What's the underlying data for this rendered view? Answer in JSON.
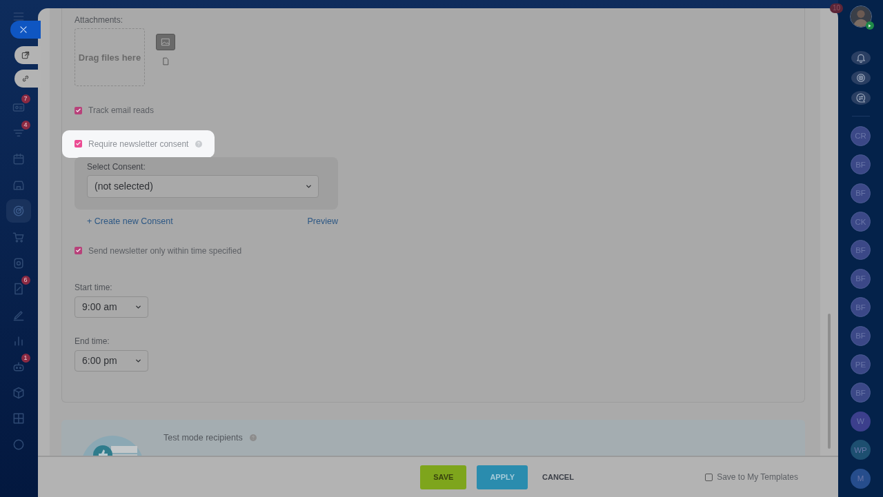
{
  "left_nav": {
    "items": [
      {
        "selected": false,
        "badge": "7"
      },
      {
        "selected": false,
        "badge": "4"
      },
      {
        "selected": false
      },
      {
        "selected": false
      },
      {
        "selected": true
      },
      {
        "selected": false
      },
      {
        "selected": false
      },
      {
        "selected": false,
        "badge": "6"
      },
      {
        "selected": false
      },
      {
        "selected": false
      },
      {
        "selected": false,
        "badge": "1"
      },
      {
        "selected": false
      },
      {
        "selected": false
      },
      {
        "selected": false
      }
    ]
  },
  "top_badge": "10",
  "form": {
    "attachments": {
      "label": "Attachments:",
      "dropzone": "Drag files here"
    },
    "track_reads": {
      "label": "Track email reads",
      "checked": true
    },
    "consent": {
      "label": "Require newsletter consent",
      "checked": true,
      "highlighted": true,
      "select_label": "Select Consent:",
      "select_value": "(not selected)",
      "create_link": "+ Create new Consent",
      "preview_link": "Preview"
    },
    "time_limit": {
      "label": "Send newsletter only within time specified",
      "checked": true
    },
    "start_time": {
      "label": "Start time:",
      "value": "9:00 am"
    },
    "end_time": {
      "label": "End time:",
      "value": "6:00 pm"
    },
    "test_mode": {
      "label": "Test mode recipients"
    }
  },
  "footer": {
    "buttons": [
      {
        "label": "SAVE",
        "kind": "primary"
      },
      {
        "label": "APPLY",
        "kind": "secondary"
      },
      {
        "label": "CANCEL",
        "kind": "link"
      }
    ],
    "save_template": {
      "label": "Save to My Templates",
      "checked": false
    }
  },
  "right_bar": {
    "contacts": [
      {
        "initials": "CR",
        "kind": "ring",
        "color": "#3b4887"
      },
      {
        "initials": "BF",
        "kind": "ring",
        "color": "#3b4887"
      },
      {
        "initials": "BF",
        "kind": "ring",
        "color": "#3b4887"
      },
      {
        "initials": "CK",
        "kind": "ring",
        "color": "#3b4887"
      },
      {
        "initials": "BF",
        "kind": "ring",
        "color": "#3b4887"
      },
      {
        "initials": "BF",
        "kind": "ring",
        "color": "#3b4887"
      },
      {
        "initials": "BF",
        "kind": "ring",
        "color": "#3b4887"
      },
      {
        "initials": "BF",
        "kind": "ring",
        "color": "#3b4887"
      },
      {
        "initials": "PE",
        "kind": "ring",
        "color": "#3b4887"
      },
      {
        "initials": "BF",
        "kind": "ring",
        "color": "#3b4887"
      },
      {
        "initials": "W",
        "kind": "plain",
        "color": "#3c3f8c"
      },
      {
        "initials": "WP",
        "kind": "plain",
        "color": "#1d4f70"
      },
      {
        "initials": "M",
        "kind": "plain",
        "color": "#264d8c"
      }
    ]
  }
}
